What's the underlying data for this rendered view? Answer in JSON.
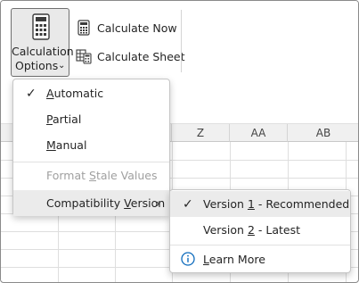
{
  "ribbon": {
    "calc_options": {
      "line1": "Calculation",
      "line2": "Options",
      "chevron": "⌄",
      "icon": "calculator-icon"
    },
    "calc_now": {
      "label": "Calculate Now",
      "icon": "calculator-small-icon"
    },
    "calc_sheet": {
      "label": "Calculate Sheet",
      "icon": "sheet-calculator-icon"
    }
  },
  "sheet": {
    "columns": [
      "Z",
      "AA",
      "AB"
    ]
  },
  "menu": {
    "items": [
      {
        "pre": "",
        "ul": "A",
        "post": "utomatic",
        "checked": true,
        "check": "✓",
        "disabled": false
      },
      {
        "pre": "",
        "ul": "P",
        "post": "artial",
        "checked": false,
        "disabled": false
      },
      {
        "pre": "",
        "ul": "M",
        "post": "anual",
        "checked": false,
        "disabled": false
      },
      {
        "pre": "Format ",
        "ul": "S",
        "post": "tale Values",
        "checked": false,
        "disabled": true
      },
      {
        "pre": "Compatibility ",
        "ul": "V",
        "post": "ersion",
        "checked": false,
        "disabled": false,
        "submenu": true,
        "arrow": "›"
      }
    ]
  },
  "submenu": {
    "items": [
      {
        "pre": "Version ",
        "ul": "1",
        "post": " - Recommended",
        "checked": true,
        "check": "✓"
      },
      {
        "pre": "Version ",
        "ul": "2",
        "post": " - Latest",
        "checked": false
      },
      {
        "pre": "",
        "ul": "L",
        "post": "earn More",
        "icon": "info-icon",
        "icon_glyph": "i"
      }
    ]
  },
  "colors": {
    "accent_blue": "#0f6cbd",
    "hover_bg": "#ebebeb",
    "disabled_text": "#a0a0a0"
  }
}
